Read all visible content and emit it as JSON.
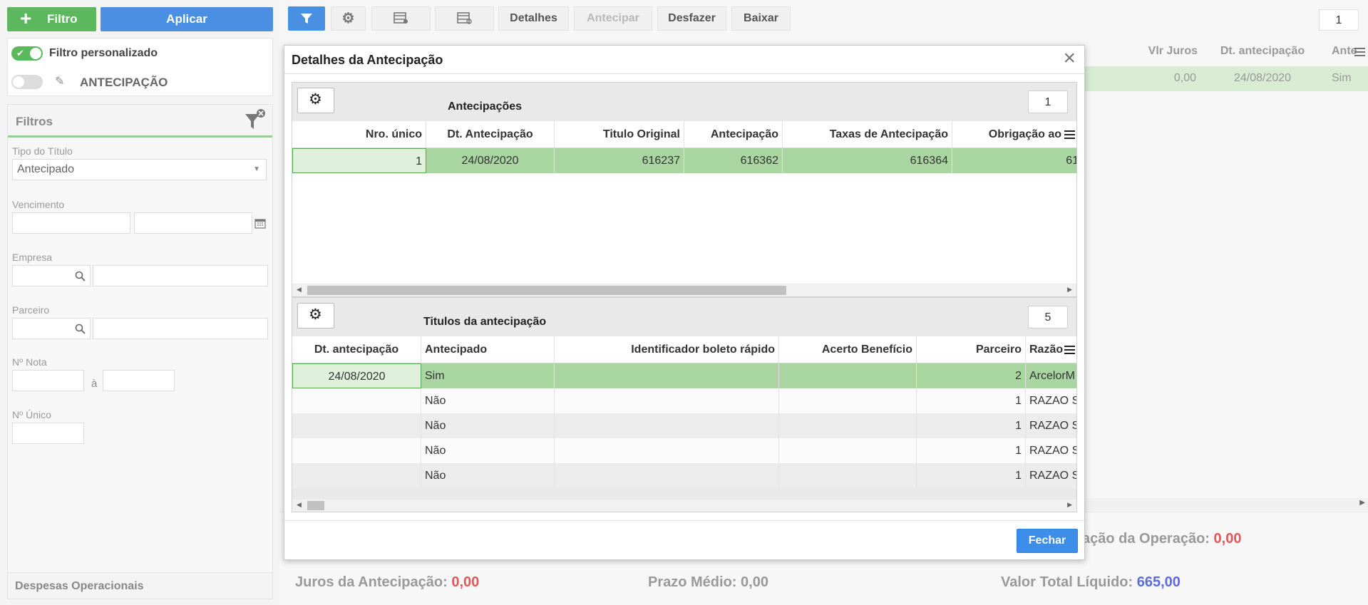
{
  "left": {
    "add_filter_label": "Filtro",
    "apply_label": "Aplicar",
    "custom_filter_label": "Filtro personalizado",
    "antecipacao_filter_label": "ANTECIPAÇÃO",
    "filters_title": "Filtros",
    "tipo_titulo_label": "Tipo do Título",
    "tipo_titulo_value": "Antecipado",
    "vencimento_label": "Vencimento",
    "empresa_label": "Empresa",
    "parceiro_label": "Parceiro",
    "nota_label": "Nº Nota",
    "nota_sep": "à",
    "unico_label": "Nº Único",
    "despesas_label": "Despesas Operacionais"
  },
  "toolbar": {
    "detalhes": "Detalhes",
    "antecipar": "Antecipar",
    "desfazer": "Desfazer",
    "baixar": "Baixar",
    "page_count": "1"
  },
  "background_grid": {
    "headers": [
      "Vlr Juros",
      "Dt. antecipação",
      "Ante"
    ],
    "row": [
      "0,00",
      "24/08/2020",
      "Sim"
    ]
  },
  "footer": {
    "juros_label": "Juros da Antecipação:",
    "juros_value": "0,00",
    "prazo_label": "Prazo Médio:",
    "prazo_value": "0,00",
    "total_label": "Valor Total Líquido:",
    "total_value": "665,00",
    "operacao_label": "ação da Operação:",
    "operacao_value": "0,00"
  },
  "modal": {
    "title": "Detalhes da Antecipação",
    "antecipacoes": {
      "title": "Antecipações",
      "count": "1",
      "columns": [
        "Nro. único",
        "Dt. Antecipação",
        "Titulo Original",
        "Antecipação",
        "Taxas de Antecipação",
        "Obrigação ao"
      ],
      "rows": [
        [
          "1",
          "24/08/2020",
          "616237",
          "616362",
          "616364",
          "616"
        ]
      ]
    },
    "titulos": {
      "title": "Titulos da antecipação",
      "count": "5",
      "columns": [
        "Dt. antecipação",
        "Antecipado",
        "Identificador boleto rápido",
        "Acerto Benefício",
        "Parceiro",
        "Razão"
      ],
      "rows": [
        [
          "24/08/2020",
          "Sim",
          "",
          "",
          "2",
          "ArcelorM"
        ],
        [
          "",
          "Não",
          "",
          "",
          "1",
          "RAZAO S"
        ],
        [
          "",
          "Não",
          "",
          "",
          "1",
          "RAZAO S"
        ],
        [
          "",
          "Não",
          "",
          "",
          "1",
          "RAZAO S"
        ],
        [
          "",
          "Não",
          "",
          "",
          "1",
          "RAZAO S"
        ]
      ]
    },
    "close_label": "Fechar"
  },
  "colors": {
    "green_button": "#5cb85c",
    "blue_button": "#4a90e2",
    "selected_row": "#a8d5a0",
    "red_value": "#e05a5a",
    "blue_value": "#5b6be0"
  }
}
